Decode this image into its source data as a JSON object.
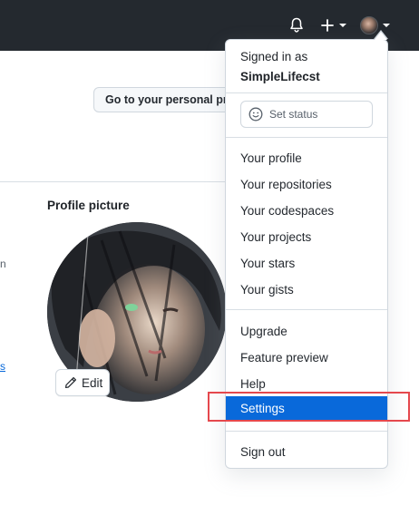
{
  "header": {
    "icons": [
      "bell-icon",
      "plus-icon",
      "chevron-down-icon",
      "avatar"
    ]
  },
  "page": {
    "goto_button_label": "Go to your personal profile",
    "goto_button_visible": "Go to your personal prof",
    "fragments": [
      "n",
      "s"
    ],
    "profile_picture_title": "Profile picture",
    "edit_label": "Edit"
  },
  "menu": {
    "signed_in_label": "Signed in as",
    "username": "SimpleLifecst",
    "set_status": "Set status",
    "group1": [
      "Your profile",
      "Your repositories",
      "Your codespaces",
      "Your projects",
      "Your stars",
      "Your gists"
    ],
    "group2": [
      "Upgrade",
      "Feature preview",
      "Help",
      "Settings"
    ],
    "active_item": "Settings",
    "sign_out": "Sign out"
  },
  "colors": {
    "header_bg": "#24292f",
    "active_bg": "#0969da",
    "highlight_border": "#e5484d"
  }
}
